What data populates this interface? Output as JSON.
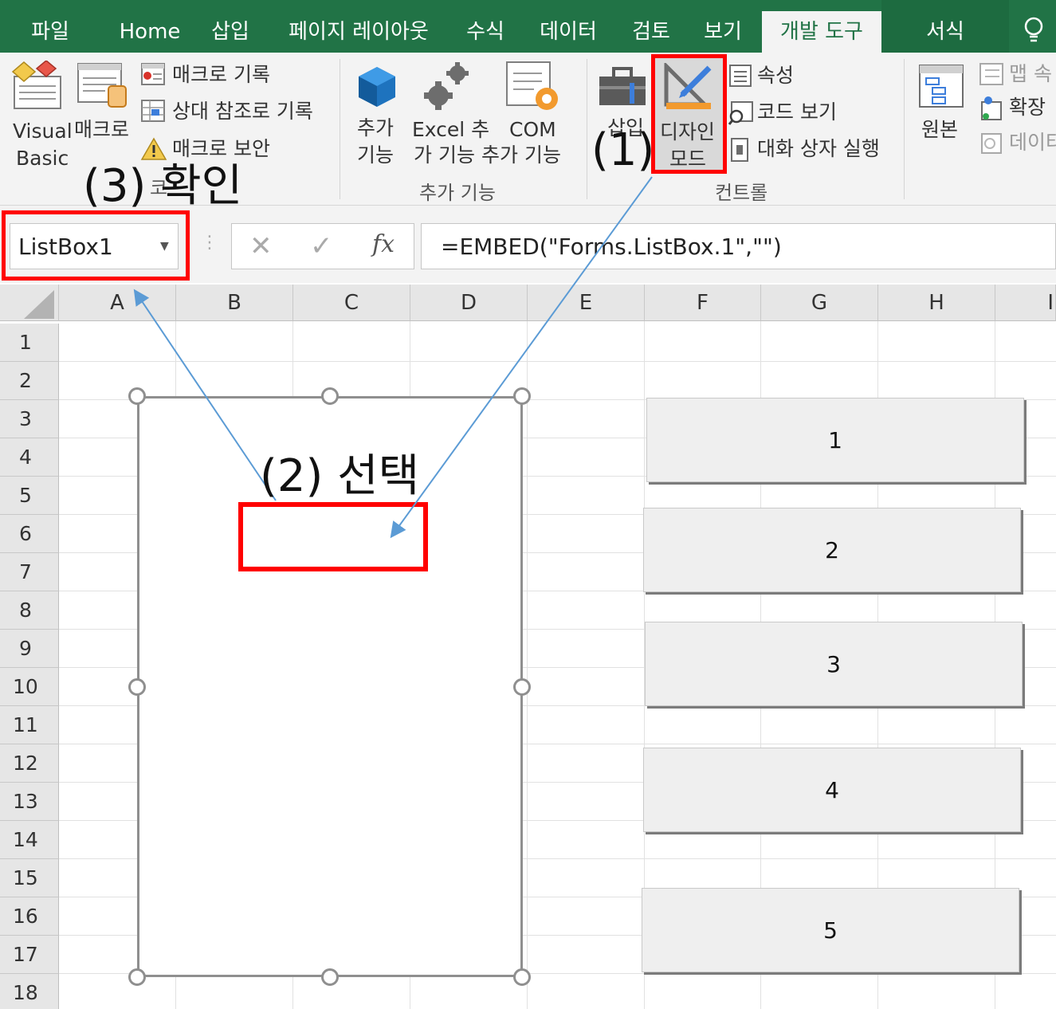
{
  "tabs": [
    {
      "label": "파일"
    },
    {
      "label": "Home"
    },
    {
      "label": "삽입"
    },
    {
      "label": "페이지 레이아웃"
    },
    {
      "label": "수식"
    },
    {
      "label": "데이터"
    },
    {
      "label": "검토"
    },
    {
      "label": "보기"
    },
    {
      "label": "개발 도구",
      "active": true
    },
    {
      "label": "서식"
    }
  ],
  "ribbon": {
    "code_group": {
      "visual_basic_1": "Visual",
      "visual_basic_2": "Basic",
      "macro": "매크로",
      "record_macro": "매크로 기록",
      "relative_ref": "상대 참조로 기록",
      "macro_security": "매크로 보안",
      "label_partial": "코"
    },
    "addins_group": {
      "addins_1": "추가",
      "addins_2": "기능",
      "excel_addins_1": "Excel 추",
      "excel_addins_2": "가 기능",
      "com_1": "COM",
      "com_2": "추가 기능",
      "label": "추가 기능"
    },
    "controls_group": {
      "insert_partial_1": "삽입",
      "design_mode_1": "디자인",
      "design_mode_2": "모드",
      "properties": "속성",
      "view_code": "코드 보기",
      "run_dialog": "대화 상자 실행",
      "label": "컨트롤"
    },
    "xml_group": {
      "source": "원본",
      "map_props": "맵 속",
      "expansion": "확장",
      "data": "데이터"
    }
  },
  "formula_bar": {
    "name_box": "ListBox1",
    "formula": "=EMBED(\"Forms.ListBox.1\",\"\")"
  },
  "grid": {
    "columns": [
      "A",
      "B",
      "C",
      "D",
      "E",
      "F",
      "G",
      "H",
      "I"
    ],
    "rows": [
      "1",
      "2",
      "3",
      "4",
      "5",
      "6",
      "7",
      "8",
      "9",
      "10",
      "11",
      "12",
      "13",
      "14",
      "15",
      "16",
      "17",
      "18"
    ]
  },
  "buttons": [
    {
      "label": "1"
    },
    {
      "label": "2"
    },
    {
      "label": "3"
    },
    {
      "label": "4"
    },
    {
      "label": "5"
    }
  ],
  "annotations": {
    "step1": "(1)",
    "step2": "(2)  선택",
    "step3": "(3) 확인"
  },
  "colors": {
    "excel_green": "#217346",
    "highlight_red": "#ff0000",
    "arrow_blue": "#5b9bd5"
  }
}
